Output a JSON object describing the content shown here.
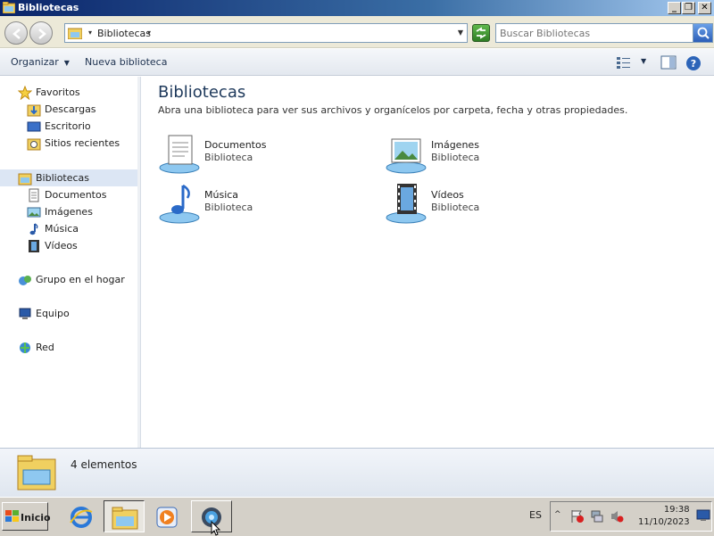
{
  "window": {
    "title": "Bibliotecas",
    "buttons": [
      "_",
      "❐",
      "✕"
    ]
  },
  "address": {
    "breadcrumb": "Bibliotecas",
    "search_placeholder": "Buscar Bibliotecas"
  },
  "commandbar": {
    "organize": "Organizar",
    "new_library": "Nueva biblioteca"
  },
  "navpane": {
    "favorites": "Favoritos",
    "favorites_items": [
      "Descargas",
      "Escritorio",
      "Sitios recientes"
    ],
    "libraries": "Bibliotecas",
    "libraries_items": [
      "Documentos",
      "Imágenes",
      "Música",
      "Vídeos"
    ],
    "homegroup": "Grupo en el hogar",
    "computer": "Equipo",
    "network": "Red"
  },
  "content": {
    "title": "Bibliotecas",
    "subtitle": "Abra una biblioteca para ver sus archivos y organícelos por carpeta, fecha y otras propiedades.",
    "libraries": [
      {
        "name": "Documentos",
        "type": "Biblioteca",
        "icon": "documents-library-icon"
      },
      {
        "name": "Imágenes",
        "type": "Biblioteca",
        "icon": "pictures-library-icon"
      },
      {
        "name": "Música",
        "type": "Biblioteca",
        "icon": "music-library-icon"
      },
      {
        "name": "Vídeos",
        "type": "Biblioteca",
        "icon": "videos-library-icon"
      }
    ]
  },
  "details": {
    "count": "4 elementos"
  },
  "taskbar": {
    "start": "Inicio",
    "lang": "ES",
    "time": "19:38",
    "date": "11/10/2023"
  },
  "colors": {
    "title_gradient_start": "#0a246a",
    "title_gradient_end": "#a6caf0",
    "content_title": "#1e395b",
    "selected_nav": "#dce6f4"
  }
}
